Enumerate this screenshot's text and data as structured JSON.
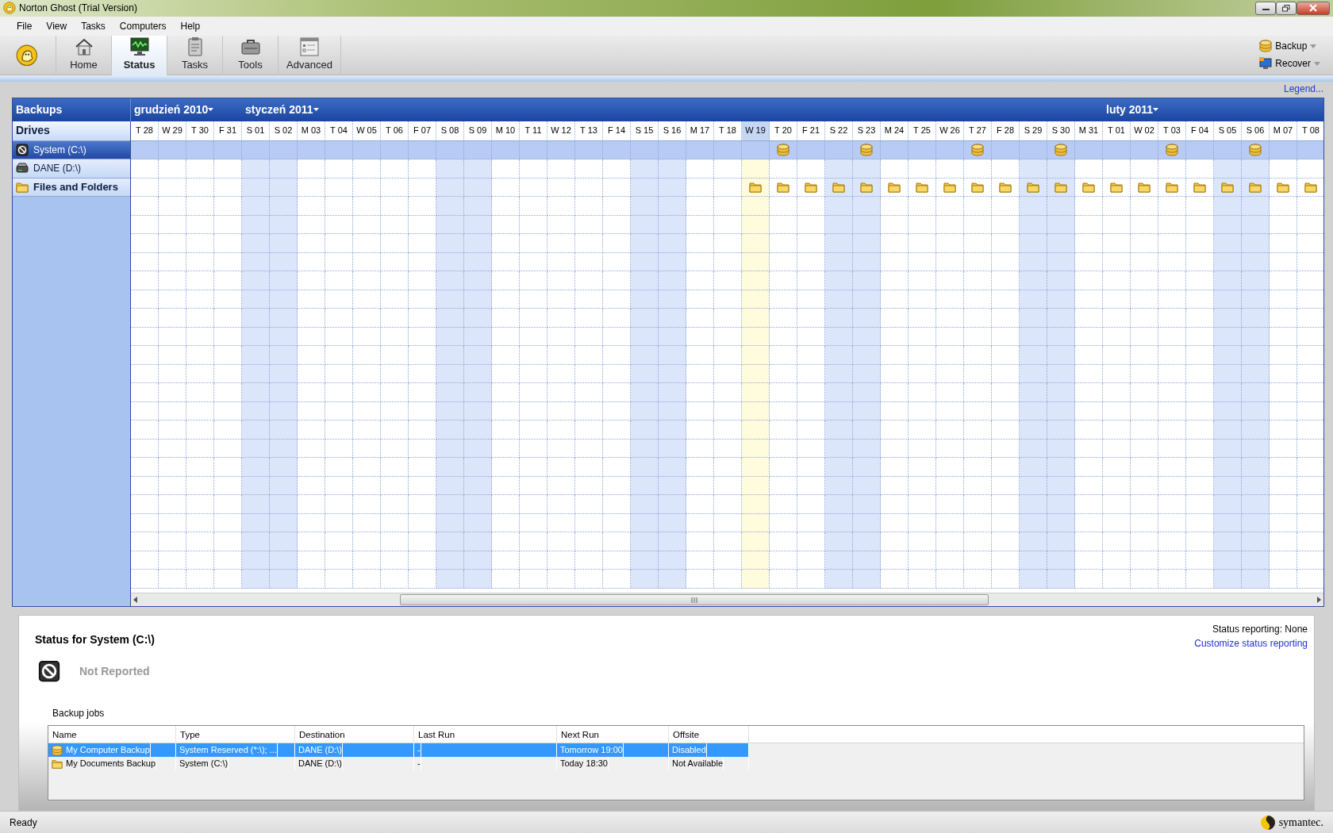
{
  "window": {
    "title": "Norton Ghost (Trial Version)"
  },
  "menu": [
    "File",
    "View",
    "Tasks",
    "Computers",
    "Help"
  ],
  "toolbar": {
    "tabs": [
      {
        "label": "Home",
        "kind": "home",
        "selected": false
      },
      {
        "label": "Status",
        "kind": "status",
        "selected": true
      },
      {
        "label": "Tasks",
        "kind": "tasks",
        "selected": false
      },
      {
        "label": "Tools",
        "kind": "tools",
        "selected": false
      },
      {
        "label": "Advanced",
        "kind": "advanced",
        "selected": false
      }
    ],
    "actions": [
      {
        "label": "Backup",
        "kind": "backup"
      },
      {
        "label": "Recover",
        "kind": "recover"
      }
    ]
  },
  "legend_link": "Legend...",
  "calendar": {
    "header": "Backups",
    "section": "Drives",
    "rows": [
      {
        "label": "System (C:\\)",
        "kind": "system-drive",
        "selected": true
      },
      {
        "label": "DANE (D:\\)",
        "kind": "data-drive",
        "selected": false
      },
      {
        "label": "Files and Folders",
        "kind": "folder-group",
        "selected": false
      }
    ],
    "months": [
      {
        "label": "grudzień 2010",
        "days": [
          {
            "label": "T 28",
            "weekend": false,
            "today": false,
            "backups": [
              false,
              false,
              false
            ]
          },
          {
            "label": "W 29",
            "weekend": false,
            "today": false,
            "backups": [
              false,
              false,
              false
            ]
          },
          {
            "label": "T 30",
            "weekend": false,
            "today": false,
            "backups": [
              false,
              false,
              false
            ]
          },
          {
            "label": "F 31",
            "weekend": false,
            "today": false,
            "backups": [
              false,
              false,
              false
            ]
          }
        ]
      },
      {
        "label": "styczeń 2011",
        "days": [
          {
            "label": "S 01",
            "weekend": true,
            "today": false,
            "backups": [
              false,
              false,
              false
            ]
          },
          {
            "label": "S 02",
            "weekend": true,
            "today": false,
            "backups": [
              false,
              false,
              false
            ]
          },
          {
            "label": "M 03",
            "weekend": false,
            "today": false,
            "backups": [
              false,
              false,
              false
            ]
          },
          {
            "label": "T 04",
            "weekend": false,
            "today": false,
            "backups": [
              false,
              false,
              false
            ]
          },
          {
            "label": "W 05",
            "weekend": false,
            "today": false,
            "backups": [
              false,
              false,
              false
            ]
          },
          {
            "label": "T 06",
            "weekend": false,
            "today": false,
            "backups": [
              false,
              false,
              false
            ]
          },
          {
            "label": "F 07",
            "weekend": false,
            "today": false,
            "backups": [
              false,
              false,
              false
            ]
          },
          {
            "label": "S 08",
            "weekend": true,
            "today": false,
            "backups": [
              false,
              false,
              false
            ]
          },
          {
            "label": "S 09",
            "weekend": true,
            "today": false,
            "backups": [
              false,
              false,
              false
            ]
          },
          {
            "label": "M 10",
            "weekend": false,
            "today": false,
            "backups": [
              false,
              false,
              false
            ]
          },
          {
            "label": "T 11",
            "weekend": false,
            "today": false,
            "backups": [
              false,
              false,
              false
            ]
          },
          {
            "label": "W 12",
            "weekend": false,
            "today": false,
            "backups": [
              false,
              false,
              false
            ]
          },
          {
            "label": "T 13",
            "weekend": false,
            "today": false,
            "backups": [
              false,
              false,
              false
            ]
          },
          {
            "label": "F 14",
            "weekend": false,
            "today": false,
            "backups": [
              false,
              false,
              false
            ]
          },
          {
            "label": "S 15",
            "weekend": true,
            "today": false,
            "backups": [
              false,
              false,
              false
            ]
          },
          {
            "label": "S 16",
            "weekend": true,
            "today": false,
            "backups": [
              false,
              false,
              false
            ]
          },
          {
            "label": "M 17",
            "weekend": false,
            "today": false,
            "backups": [
              false,
              false,
              false
            ]
          },
          {
            "label": "T 18",
            "weekend": false,
            "today": false,
            "backups": [
              false,
              false,
              false
            ]
          },
          {
            "label": "W 19",
            "weekend": false,
            "today": true,
            "backups": [
              false,
              false,
              true
            ]
          },
          {
            "label": "T 20",
            "weekend": false,
            "today": false,
            "backups": [
              true,
              false,
              true
            ]
          },
          {
            "label": "F 21",
            "weekend": false,
            "today": false,
            "backups": [
              false,
              false,
              true
            ]
          },
          {
            "label": "S 22",
            "weekend": true,
            "today": false,
            "backups": [
              false,
              false,
              true
            ]
          },
          {
            "label": "S 23",
            "weekend": true,
            "today": false,
            "backups": [
              true,
              false,
              true
            ]
          },
          {
            "label": "M 24",
            "weekend": false,
            "today": false,
            "backups": [
              false,
              false,
              true
            ]
          },
          {
            "label": "T 25",
            "weekend": false,
            "today": false,
            "backups": [
              false,
              false,
              true
            ]
          },
          {
            "label": "W 26",
            "weekend": false,
            "today": false,
            "backups": [
              false,
              false,
              true
            ]
          },
          {
            "label": "T 27",
            "weekend": false,
            "today": false,
            "backups": [
              true,
              false,
              true
            ]
          },
          {
            "label": "F 28",
            "weekend": false,
            "today": false,
            "backups": [
              false,
              false,
              true
            ]
          },
          {
            "label": "S 29",
            "weekend": true,
            "today": false,
            "backups": [
              false,
              false,
              true
            ]
          },
          {
            "label": "S 30",
            "weekend": true,
            "today": false,
            "backups": [
              true,
              false,
              true
            ]
          },
          {
            "label": "M 31",
            "weekend": false,
            "today": false,
            "backups": [
              false,
              false,
              true
            ]
          }
        ]
      },
      {
        "label": "luty 2011",
        "days": [
          {
            "label": "T 01",
            "weekend": false,
            "today": false,
            "backups": [
              false,
              false,
              true
            ]
          },
          {
            "label": "W 02",
            "weekend": false,
            "today": false,
            "backups": [
              false,
              false,
              true
            ]
          },
          {
            "label": "T 03",
            "weekend": false,
            "today": false,
            "backups": [
              true,
              false,
              true
            ]
          },
          {
            "label": "F 04",
            "weekend": false,
            "today": false,
            "backups": [
              false,
              false,
              true
            ]
          },
          {
            "label": "S 05",
            "weekend": true,
            "today": false,
            "backups": [
              false,
              false,
              true
            ]
          },
          {
            "label": "S 06",
            "weekend": true,
            "today": false,
            "backups": [
              true,
              false,
              true
            ]
          },
          {
            "label": "M 07",
            "weekend": false,
            "today": false,
            "backups": [
              false,
              false,
              true
            ]
          },
          {
            "label": "T 08",
            "weekend": false,
            "today": false,
            "backups": [
              false,
              false,
              true
            ]
          }
        ]
      }
    ]
  },
  "status": {
    "title": "Status for System (C:\\)",
    "state": "Not Reported",
    "reporting": "Status reporting: None",
    "customize_link": "Customize status reporting",
    "jobs_label": "Backup jobs",
    "jobs": {
      "columns": [
        "Name",
        "Type",
        "Destination",
        "Last Run",
        "Next Run",
        "Offsite"
      ],
      "rows": [
        {
          "kind": "drive",
          "selected": true,
          "cells": [
            "My Computer Backup",
            "System Reserved (*:\\); ...",
            "DANE (D:\\)",
            "-",
            "Tomorrow 19:00",
            "Disabled"
          ]
        },
        {
          "kind": "folder",
          "selected": false,
          "cells": [
            "My Documents Backup",
            "System (C:\\)",
            "DANE (D:\\)",
            "-",
            "Today 18:30",
            "Not Available"
          ]
        }
      ]
    }
  },
  "status_bar": {
    "text": "Ready",
    "brand": "symantec."
  }
}
